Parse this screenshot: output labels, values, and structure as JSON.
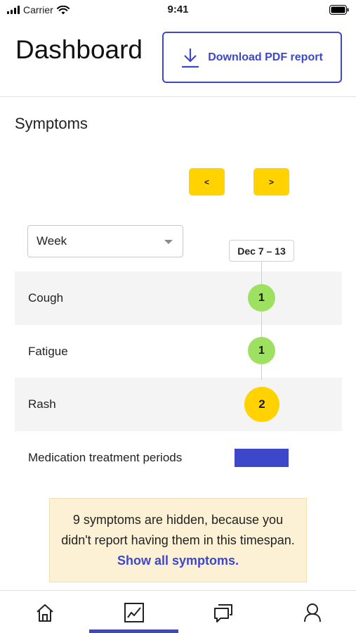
{
  "status_bar": {
    "carrier": "Carrier",
    "time": "9:41"
  },
  "header": {
    "title": "Dashboard",
    "download_label": "Download PDF report"
  },
  "symptoms": {
    "title": "Symptoms",
    "prev_label": "<",
    "next_label": ">",
    "period": "Week",
    "date_range": "Dec 7 – 13",
    "rows": [
      {
        "name": "Cough",
        "count": "1",
        "color": "#9ee05f"
      },
      {
        "name": "Fatigue",
        "count": "1",
        "color": "#9ee05f"
      },
      {
        "name": "Rash",
        "count": "2",
        "color": "#ffd200"
      }
    ],
    "medication_label": "Medication treatment periods",
    "medication_color": "#3d47c9",
    "notice_text": "9 symptoms are hidden, because you didn't report having them in this timespan.",
    "notice_link": "Show all symptoms."
  },
  "tab_bar": {
    "items": [
      "home-icon",
      "chart-icon",
      "chat-icon",
      "profile-icon"
    ],
    "active_color": "#3d47c9"
  }
}
